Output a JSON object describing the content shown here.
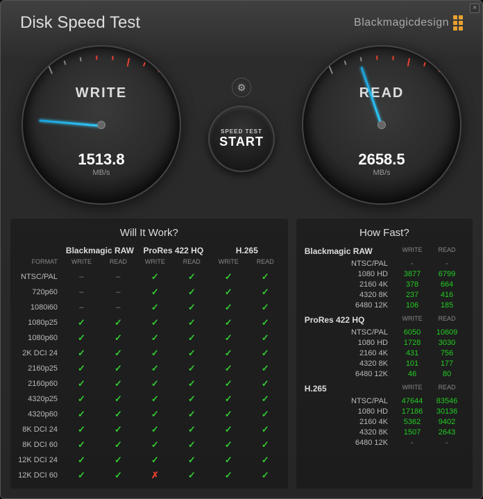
{
  "title": "Disk Speed Test",
  "brand": "Blackmagicdesign",
  "gauges": {
    "write": {
      "label": "WRITE",
      "value": "1513.8",
      "unit": "MB/s",
      "angle": 185
    },
    "read": {
      "label": "READ",
      "value": "2658.5",
      "unit": "MB/s",
      "angle": 251
    }
  },
  "startButton": {
    "small": "SPEED TEST",
    "big": "START"
  },
  "willItWork": {
    "title": "Will It Work?",
    "formatHeader": "FORMAT",
    "colLabels": {
      "write": "WRITE",
      "read": "READ"
    },
    "codecs": [
      "Blackmagic RAW",
      "ProRes 422 HQ",
      "H.265"
    ],
    "rows": [
      {
        "fmt": "NTSC/PAL",
        "cells": [
          "-",
          "-",
          "✓",
          "✓",
          "✓",
          "✓"
        ]
      },
      {
        "fmt": "720p60",
        "cells": [
          "-",
          "-",
          "✓",
          "✓",
          "✓",
          "✓"
        ]
      },
      {
        "fmt": "1080i60",
        "cells": [
          "-",
          "-",
          "✓",
          "✓",
          "✓",
          "✓"
        ]
      },
      {
        "fmt": "1080p25",
        "cells": [
          "✓",
          "✓",
          "✓",
          "✓",
          "✓",
          "✓"
        ]
      },
      {
        "fmt": "1080p60",
        "cells": [
          "✓",
          "✓",
          "✓",
          "✓",
          "✓",
          "✓"
        ]
      },
      {
        "fmt": "2K DCI 24",
        "cells": [
          "✓",
          "✓",
          "✓",
          "✓",
          "✓",
          "✓"
        ]
      },
      {
        "fmt": "2160p25",
        "cells": [
          "✓",
          "✓",
          "✓",
          "✓",
          "✓",
          "✓"
        ]
      },
      {
        "fmt": "2160p60",
        "cells": [
          "✓",
          "✓",
          "✓",
          "✓",
          "✓",
          "✓"
        ]
      },
      {
        "fmt": "4320p25",
        "cells": [
          "✓",
          "✓",
          "✓",
          "✓",
          "✓",
          "✓"
        ]
      },
      {
        "fmt": "4320p60",
        "cells": [
          "✓",
          "✓",
          "✓",
          "✓",
          "✓",
          "✓"
        ]
      },
      {
        "fmt": "8K DCI 24",
        "cells": [
          "✓",
          "✓",
          "✓",
          "✓",
          "✓",
          "✓"
        ]
      },
      {
        "fmt": "8K DCI 60",
        "cells": [
          "✓",
          "✓",
          "✓",
          "✓",
          "✓",
          "✓"
        ]
      },
      {
        "fmt": "12K DCI 24",
        "cells": [
          "✓",
          "✓",
          "✓",
          "✓",
          "✓",
          "✓"
        ]
      },
      {
        "fmt": "12K DCI 60",
        "cells": [
          "✓",
          "✓",
          "✗",
          "✓",
          "✓",
          "✓"
        ]
      }
    ]
  },
  "howFast": {
    "title": "How Fast?",
    "colLabels": {
      "write": "WRITE",
      "read": "READ"
    },
    "groups": [
      {
        "name": "Blackmagic RAW",
        "rows": [
          {
            "fmt": "NTSC/PAL",
            "w": "-",
            "r": "-"
          },
          {
            "fmt": "1080 HD",
            "w": "3877",
            "r": "6799"
          },
          {
            "fmt": "2160 4K",
            "w": "378",
            "r": "664"
          },
          {
            "fmt": "4320 8K",
            "w": "237",
            "r": "416"
          },
          {
            "fmt": "6480 12K",
            "w": "106",
            "r": "185"
          }
        ]
      },
      {
        "name": "ProRes 422 HQ",
        "rows": [
          {
            "fmt": "NTSC/PAL",
            "w": "6050",
            "r": "10609"
          },
          {
            "fmt": "1080 HD",
            "w": "1728",
            "r": "3030"
          },
          {
            "fmt": "2160 4K",
            "w": "431",
            "r": "756"
          },
          {
            "fmt": "4320 8K",
            "w": "101",
            "r": "177"
          },
          {
            "fmt": "6480 12K",
            "w": "46",
            "r": "80"
          }
        ]
      },
      {
        "name": "H.265",
        "rows": [
          {
            "fmt": "NTSC/PAL",
            "w": "47644",
            "r": "83546"
          },
          {
            "fmt": "1080 HD",
            "w": "17186",
            "r": "30136"
          },
          {
            "fmt": "2160 4K",
            "w": "5362",
            "r": "9402"
          },
          {
            "fmt": "4320 8K",
            "w": "1507",
            "r": "2643"
          },
          {
            "fmt": "6480 12K",
            "w": "-",
            "r": "-"
          }
        ]
      }
    ]
  }
}
